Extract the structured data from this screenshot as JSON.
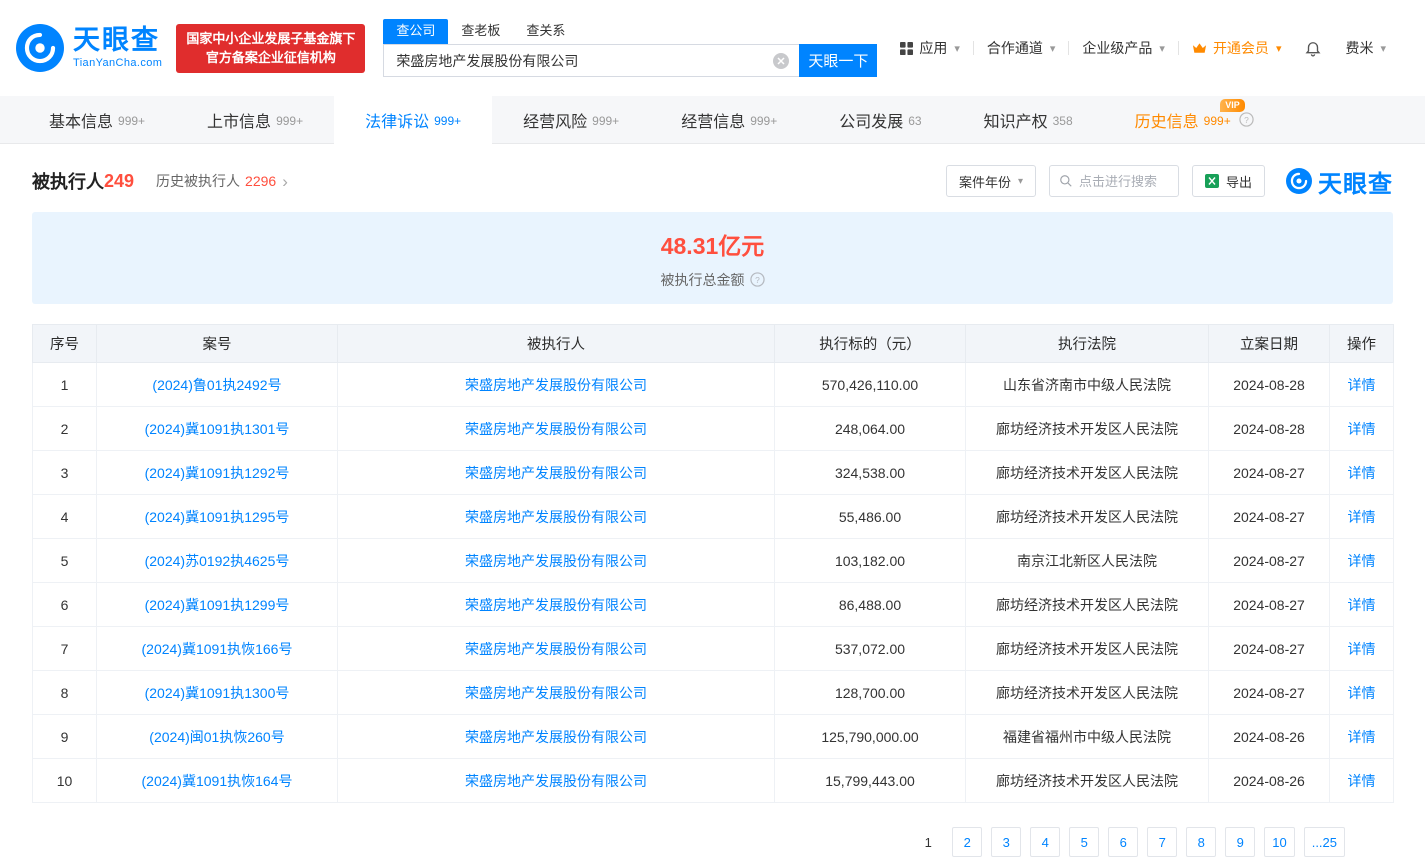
{
  "brand": {
    "name": "天眼查",
    "domain": "TianYanCha.com",
    "badge_line1": "国家中小企业发展子基金旗下",
    "badge_line2": "官方备案企业征信机构"
  },
  "search": {
    "tabs": [
      {
        "label": "查公司"
      },
      {
        "label": "查老板"
      },
      {
        "label": "查关系"
      }
    ],
    "value": "荣盛房地产发展股份有限公司",
    "button_label": "天眼一下"
  },
  "top_nav": {
    "apps": "应用",
    "cooperation": "合作通道",
    "enterprise": "企业级产品",
    "vip": "开通会员",
    "user": "费米"
  },
  "tabs": [
    {
      "label": "基本信息",
      "count": "999+"
    },
    {
      "label": "上市信息",
      "count": "999+"
    },
    {
      "label": "法律诉讼",
      "count": "999+"
    },
    {
      "label": "经营风险",
      "count": "999+"
    },
    {
      "label": "经营信息",
      "count": "999+"
    },
    {
      "label": "公司发展",
      "count": "63"
    },
    {
      "label": "知识产权",
      "count": "358"
    },
    {
      "label": "历史信息",
      "count": "999+",
      "vip_tag": "VIP"
    }
  ],
  "section": {
    "title": "被执行人",
    "count": "249",
    "history_label": "历史被执行人",
    "history_count": "2296",
    "year_filter_label": "案件年份",
    "search_placeholder": "点击进行搜索",
    "export_label": "导出",
    "logo_text": "天眼查"
  },
  "summary": {
    "amount": "48.31亿元",
    "label": "被执行总金额"
  },
  "table": {
    "headers": [
      "序号",
      "案号",
      "被执行人",
      "执行标的（元）",
      "执行法院",
      "立案日期",
      "操作"
    ],
    "detail_label": "详情",
    "rows": [
      {
        "seq": "1",
        "case_no": "(2024)鲁01执2492号",
        "person": "荣盛房地产发展股份有限公司",
        "amount": "570,426,110.00",
        "court": "山东省济南市中级人民法院",
        "date": "2024-08-28"
      },
      {
        "seq": "2",
        "case_no": "(2024)冀1091执1301号",
        "person": "荣盛房地产发展股份有限公司",
        "amount": "248,064.00",
        "court": "廊坊经济技术开发区人民法院",
        "date": "2024-08-28"
      },
      {
        "seq": "3",
        "case_no": "(2024)冀1091执1292号",
        "person": "荣盛房地产发展股份有限公司",
        "amount": "324,538.00",
        "court": "廊坊经济技术开发区人民法院",
        "date": "2024-08-27"
      },
      {
        "seq": "4",
        "case_no": "(2024)冀1091执1295号",
        "person": "荣盛房地产发展股份有限公司",
        "amount": "55,486.00",
        "court": "廊坊经济技术开发区人民法院",
        "date": "2024-08-27"
      },
      {
        "seq": "5",
        "case_no": "(2024)苏0192执4625号",
        "person": "荣盛房地产发展股份有限公司",
        "amount": "103,182.00",
        "court": "南京江北新区人民法院",
        "date": "2024-08-27"
      },
      {
        "seq": "6",
        "case_no": "(2024)冀1091执1299号",
        "person": "荣盛房地产发展股份有限公司",
        "amount": "86,488.00",
        "court": "廊坊经济技术开发区人民法院",
        "date": "2024-08-27"
      },
      {
        "seq": "7",
        "case_no": "(2024)冀1091执恢166号",
        "person": "荣盛房地产发展股份有限公司",
        "amount": "537,072.00",
        "court": "廊坊经济技术开发区人民法院",
        "date": "2024-08-27"
      },
      {
        "seq": "8",
        "case_no": "(2024)冀1091执1300号",
        "person": "荣盛房地产发展股份有限公司",
        "amount": "128,700.00",
        "court": "廊坊经济技术开发区人民法院",
        "date": "2024-08-27"
      },
      {
        "seq": "9",
        "case_no": "(2024)闽01执恢260号",
        "person": "荣盛房地产发展股份有限公司",
        "amount": "125,790,000.00",
        "court": "福建省福州市中级人民法院",
        "date": "2024-08-26"
      },
      {
        "seq": "10",
        "case_no": "(2024)冀1091执恢164号",
        "person": "荣盛房地产发展股份有限公司",
        "amount": "15,799,443.00",
        "court": "廊坊经济技术开发区人民法院",
        "date": "2024-08-26"
      }
    ]
  },
  "pagination": {
    "pages": [
      "1",
      "2",
      "3",
      "4",
      "5",
      "6",
      "7",
      "8",
      "9",
      "10",
      "...25"
    ]
  }
}
